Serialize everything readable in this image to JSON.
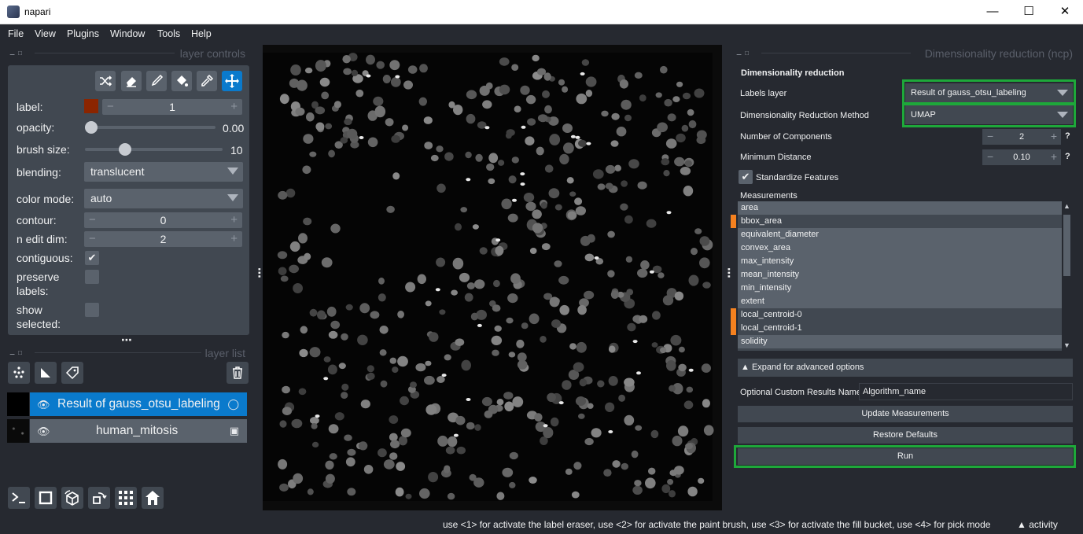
{
  "window": {
    "title": "napari",
    "minimize_icon": "—",
    "maximize_icon": "☐",
    "close_icon": "✕"
  },
  "menu": [
    "File",
    "View",
    "Plugins",
    "Window",
    "Tools",
    "Help"
  ],
  "layer_controls": {
    "header": "layer controls",
    "tools": [
      "shuffle-icon",
      "eraser-icon",
      "paint-brush-icon",
      "fill-bucket-icon",
      "color-picker-icon",
      "pan-zoom-icon"
    ],
    "label_label": "label:",
    "label_value": "1",
    "label_color": "#8b2500",
    "opacity_label": "opacity:",
    "opacity_value": "0.00",
    "opacity_fraction": 0.0,
    "brush_size_label": "brush size:",
    "brush_size_value": "10",
    "brush_size_fraction": 0.27,
    "blending_label": "blending:",
    "blending_value": "translucent",
    "color_mode_label": "color mode:",
    "color_mode_value": "auto",
    "contour_label": "contour:",
    "contour_value": "0",
    "n_edit_dim_label": "n edit dim:",
    "n_edit_dim_value": "2",
    "contiguous_label": "contiguous:",
    "contiguous_checked": true,
    "preserve_labels_label_1": "preserve",
    "preserve_labels_label_2": "labels:",
    "preserve_labels_checked": false,
    "show_selected_label_1": "show",
    "show_selected_label_2": "selected:",
    "show_selected_checked": false
  },
  "layer_list": {
    "header": "layer list",
    "buttons": [
      "new-points-icon",
      "new-shapes-icon",
      "new-labels-icon",
      "delete-layer-icon"
    ],
    "layers": [
      {
        "name": "Result of gauss_otsu_labeling",
        "selected": true,
        "type_icon": "label-tag-icon"
      },
      {
        "name": "human_mitosis",
        "selected": false,
        "type_icon": "image-icon"
      }
    ]
  },
  "viewer_buttons": [
    "console-icon",
    "ndisplay-icon",
    "roll-dims-icon",
    "transpose-icon",
    "grid-icon",
    "home-icon"
  ],
  "dimred": {
    "header": "Dimensionality reduction (ncp)",
    "section_title": "Dimensionality reduction",
    "labels_layer_label": "Labels layer",
    "labels_layer_value": "Result of gauss_otsu_labeling",
    "method_label": "Dimensionality Reduction Method",
    "method_value": "UMAP",
    "n_components_label": "Number of Components",
    "n_components_value": "2",
    "min_distance_label": "Minimum Distance",
    "min_distance_value": "0.10",
    "help_mark": "?",
    "standardize_label": "Standardize Features",
    "standardize_checked": true,
    "measurements_label": "Measurements",
    "measurements": [
      {
        "name": "area",
        "selected": true,
        "marked": false
      },
      {
        "name": "bbox_area",
        "selected": false,
        "marked": true
      },
      {
        "name": "equivalent_diameter",
        "selected": true,
        "marked": false
      },
      {
        "name": "convex_area",
        "selected": true,
        "marked": false
      },
      {
        "name": "max_intensity",
        "selected": true,
        "marked": false
      },
      {
        "name": "mean_intensity",
        "selected": true,
        "marked": false
      },
      {
        "name": "min_intensity",
        "selected": true,
        "marked": false
      },
      {
        "name": "extent",
        "selected": true,
        "marked": false
      },
      {
        "name": "local_centroid-0",
        "selected": false,
        "marked": true
      },
      {
        "name": "local_centroid-1",
        "selected": false,
        "marked": true
      },
      {
        "name": "solidity",
        "selected": true,
        "marked": false
      }
    ],
    "advanced_label": "▲ Expand for advanced options",
    "custom_name_label": "Optional Custom Results Name",
    "custom_name_value": "Algorithm_name",
    "update_button": "Update Measurements",
    "restore_button": "Restore Defaults",
    "run_button": "Run"
  },
  "status": {
    "message": "use <1> for activate the label eraser, use <2> for activate the paint brush, use <3> for activate the fill bucket, use <4> for pick mode",
    "activity": "▲ activity"
  },
  "colors": {
    "accent": "#0a7acc",
    "highlight_green": "#1ea83a",
    "marker_orange": "#f5811f",
    "background": "#262930"
  }
}
